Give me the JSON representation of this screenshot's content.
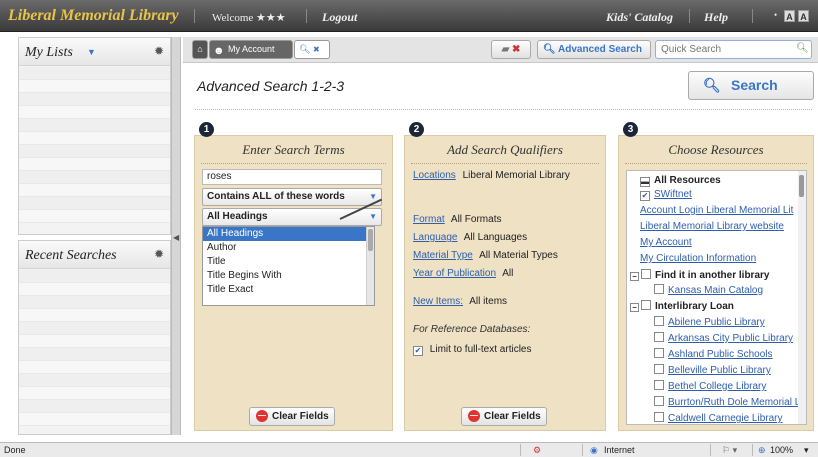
{
  "topbar": {
    "brand": "Liberal Memorial Library",
    "welcome_label": "Welcome",
    "welcome_user": "★★★",
    "logout": "Logout",
    "kids_catalog": "Kids' Catalog",
    "help": "Help",
    "font_small": "A",
    "font_large": "A"
  },
  "sidebar": {
    "my_lists": "My Lists",
    "recent_searches": "Recent Searches"
  },
  "tabs": {
    "my_account": "My Account",
    "search_tab": "✖"
  },
  "toolbar": {
    "clear_icon": "✖",
    "advanced_search": "Advanced Search",
    "quick_search_placeholder": "Quick Search"
  },
  "main": {
    "title": "Advanced Search 1-2-3",
    "search_button": "Search"
  },
  "step1": {
    "number": "1",
    "title": "Enter Search Terms",
    "term_value": "roses",
    "match_select": "Contains ALL of these words",
    "field_select": "All Headings",
    "dropdown_options": [
      "All Headings",
      "Author",
      "Title",
      "Title Begins With",
      "Title Exact"
    ],
    "clear_fields": "Clear Fields"
  },
  "step2": {
    "number": "2",
    "title": "Add Search Qualifiers",
    "locations_label": "Locations",
    "locations_value": "Liberal Memorial Library",
    "format_label": "Format",
    "format_value": "All Formats",
    "language_label": "Language",
    "language_value": "All Languages",
    "material_label": "Material Type",
    "material_value": "All Material Types",
    "year_label": "Year of Publication",
    "year_value": "All",
    "new_items_label": "New Items:",
    "new_items_value": "All items",
    "ref_db_label": "For Reference Databases:",
    "limit_fulltext": "Limit to full-text articles",
    "clear_fields": "Clear Fields"
  },
  "step3": {
    "number": "3",
    "title": "Choose Resources",
    "all_resources": "All Resources",
    "swiftnet": "SWiftnet",
    "links": [
      "Account Login Liberal Memorial Lit",
      "Liberal Memorial Library website",
      "My Account",
      "My Circulation Information"
    ],
    "find_another": "Find it in another library",
    "kansas_main": "Kansas Main Catalog",
    "interlibrary": "Interlibrary Loan",
    "libraries": [
      "Abilene Public Library",
      "Arkansas City Public Library",
      "Ashland Public Schools",
      "Belleville Public Library",
      "Bethel College Library",
      "Burrton/Ruth Dole Memorial L",
      "Caldwell Carnegie Library"
    ]
  },
  "statusbar": {
    "status": "Done",
    "zone": "Internet",
    "zoom": "100%"
  }
}
